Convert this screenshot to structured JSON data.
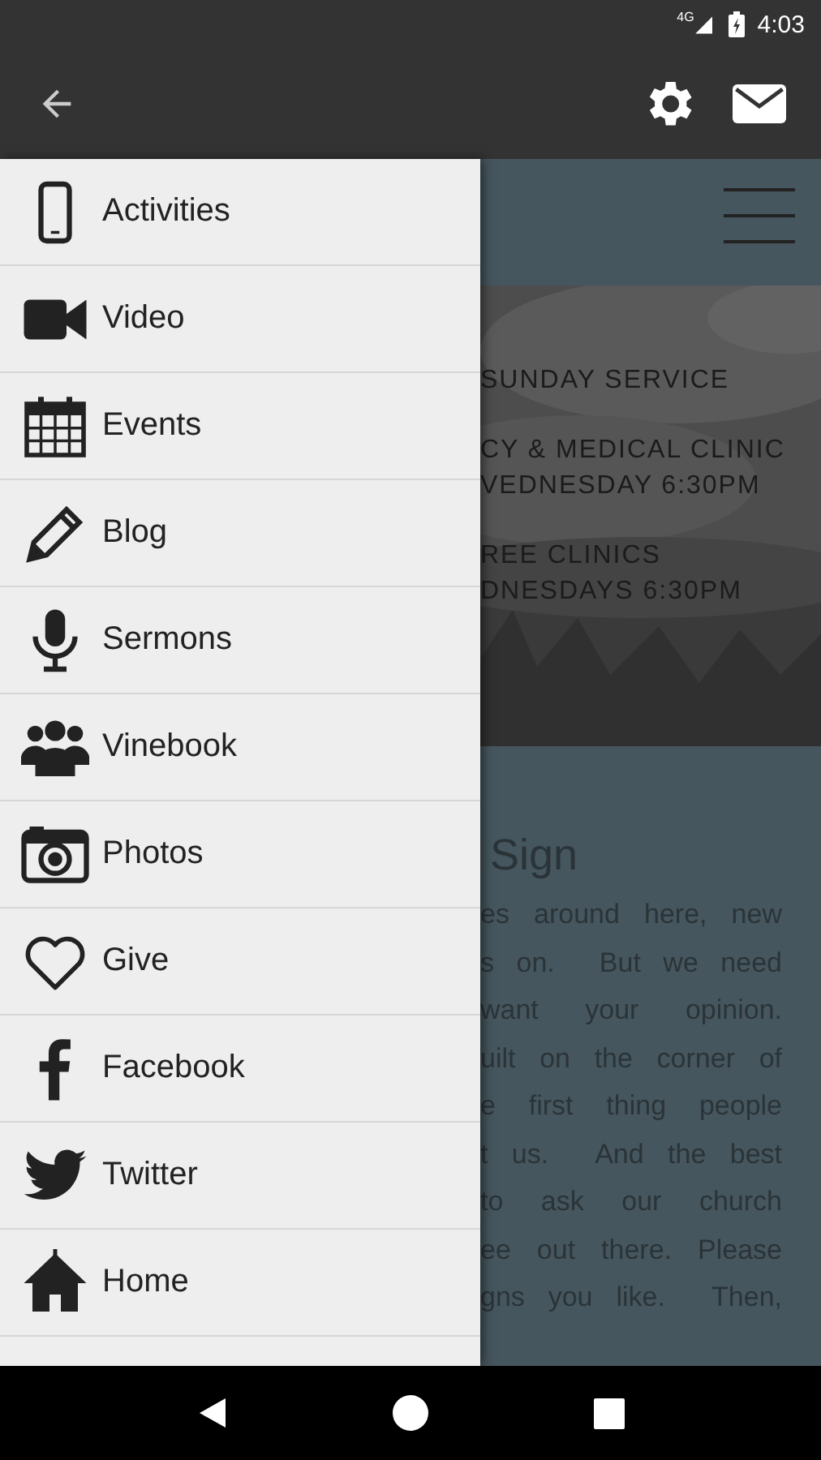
{
  "status_bar": {
    "network": "4G",
    "time": "4:03"
  },
  "app_bar": {
    "actions": [
      {
        "kind": "settings"
      },
      {
        "kind": "mail"
      }
    ]
  },
  "drawer": {
    "items": [
      {
        "label": "Activities",
        "kind": "phone"
      },
      {
        "label": "Video",
        "kind": "video"
      },
      {
        "label": "Events",
        "kind": "calendar"
      },
      {
        "label": "Blog",
        "kind": "pencil"
      },
      {
        "label": "Sermons",
        "kind": "mic"
      },
      {
        "label": "Vinebook",
        "kind": "people"
      },
      {
        "label": "Photos",
        "kind": "camera"
      },
      {
        "label": "Give",
        "kind": "heart"
      },
      {
        "label": "Facebook",
        "kind": "facebook"
      },
      {
        "label": "Twitter",
        "kind": "twitter"
      },
      {
        "label": "Home",
        "kind": "house"
      }
    ]
  },
  "page": {
    "banner_lines": [
      "SUNDAY SERVICE",
      "CY & MEDICAL CLINIC",
      "VEDNESDAY 6:30PM",
      "REE CLINICS",
      "DNESDAYS 6:30PM"
    ],
    "heading": "Sign",
    "paragraph": [
      "es around here, new",
      "s on.  But we need",
      "want your opinion.",
      "uilt on the corner of",
      "e first thing people",
      "t us.  And the best",
      "to ask our church",
      "ee out there. Please",
      "gns you like.  Then,"
    ]
  }
}
